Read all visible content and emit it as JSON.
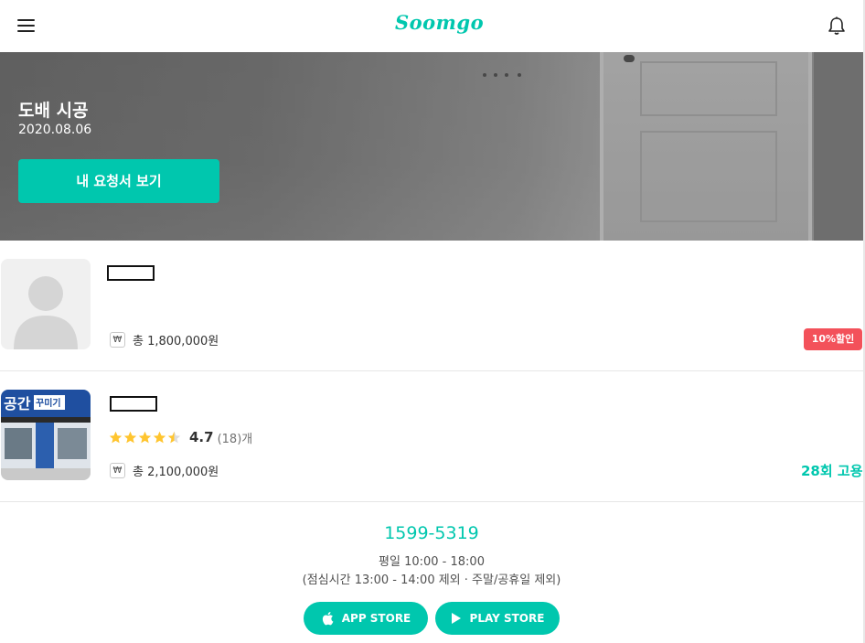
{
  "header": {
    "logo_text": "Soomgo",
    "menu_icon": "hamburger-menu-icon",
    "bell_icon": "bell-icon"
  },
  "hero": {
    "title": "도배 시공",
    "date": "2020.08.06",
    "button_label": "내 요청서 보기"
  },
  "quotes": [
    {
      "price_icon": "₩",
      "price": "총 1,800,000원",
      "badge": "10%할인"
    },
    {
      "thumb_sign_main": "공간",
      "thumb_sign_sub": "꾸미기",
      "rating": "4.7",
      "review_count": "(18)개",
      "stars": 4.5,
      "price_icon": "₩",
      "price": "총 2,100,000원",
      "hires": "28회 고용"
    }
  ],
  "footer": {
    "phone": "1599-5319",
    "hours": "평일 10:00 - 18:00",
    "note": "(점심시간 13:00 - 14:00 제외 · 주말/공휴일 제외)",
    "app_store_label": "APP STORE",
    "play_store_label": "PLAY STORE"
  },
  "colors": {
    "accent": "#00c7ae",
    "badge": "#f3515a",
    "star": "#ffc52f"
  }
}
